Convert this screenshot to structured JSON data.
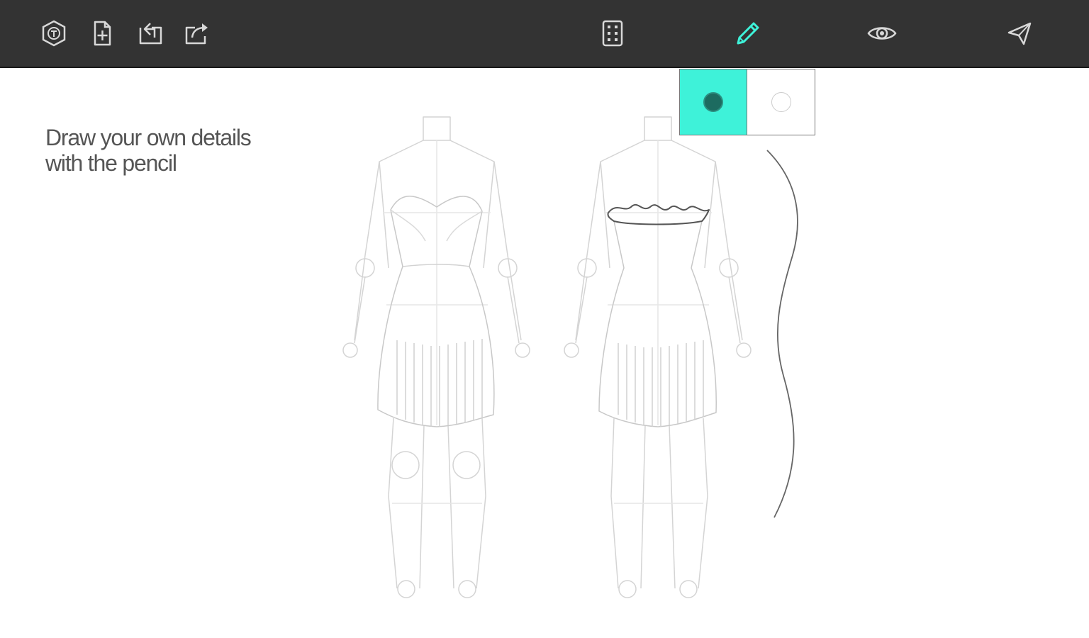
{
  "toolbar": {
    "left_tools": [
      {
        "icon": "tag-icon",
        "name": "tag-button"
      },
      {
        "icon": "new-file-icon",
        "name": "new-file-button"
      },
      {
        "icon": "folder-open-icon",
        "name": "open-button"
      },
      {
        "icon": "share-export-icon",
        "name": "export-button"
      }
    ],
    "right_tools": [
      {
        "icon": "grid-icon",
        "name": "layout-button"
      },
      {
        "icon": "pencil-icon",
        "name": "pencil-button",
        "active": true
      },
      {
        "icon": "eye-icon",
        "name": "preview-button"
      },
      {
        "icon": "send-icon",
        "name": "send-button"
      }
    ],
    "background": "#333333",
    "icon_color": "#d8d8d8",
    "active_color": "#3ef2d9"
  },
  "hint": {
    "line1": "Draw your own details",
    "line2": "with the pencil"
  },
  "brush_swatches": [
    {
      "name": "dark-brush-swatch",
      "background": "#3ef2d9",
      "dot": "#1d6b60",
      "selected": true
    },
    {
      "name": "white-brush-swatch",
      "background": "#ffffff",
      "dot": "#ffffff",
      "selected": false
    }
  ],
  "canvas": {
    "figures": [
      "front-view-figure",
      "back-view-figure"
    ],
    "sketch_line_color": "#cccccc",
    "drawn_stroke_color": "#666666"
  }
}
